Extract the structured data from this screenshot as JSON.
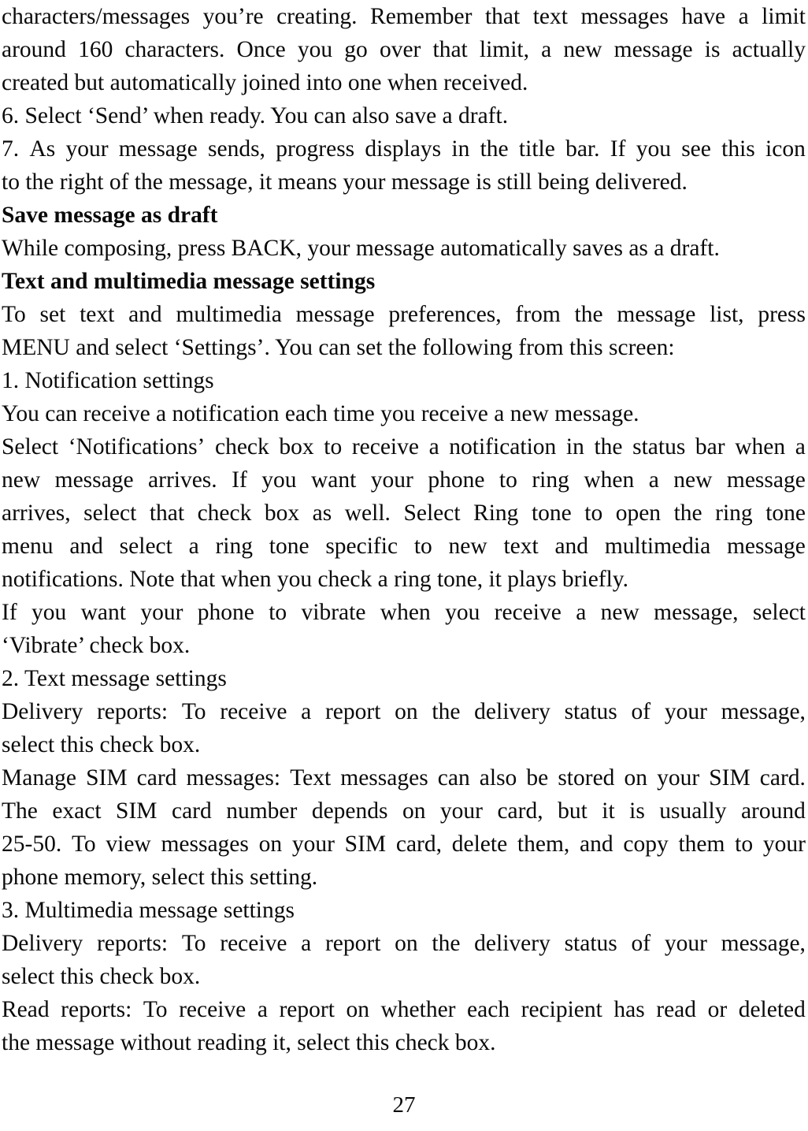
{
  "document": {
    "type": "user-manual-page",
    "page_number": "27",
    "language": "en",
    "body_lines": [
      {
        "text": "characters/messages you’re creating. Remember that text messages have a limit",
        "style": "justified"
      },
      {
        "text": "around 160 characters. Once you go over that limit, a new message is actually",
        "style": "justified"
      },
      {
        "text": "created but automatically joined into one when received.",
        "style": "normal"
      },
      {
        "text": "6. Select ‘Send’ when ready. You can also save a draft.",
        "style": "normal"
      },
      {
        "text": "7. As your message sends, progress displays in the title bar. If you see this icon",
        "style": "justified"
      },
      {
        "text": "to the right of the message, it means your message is still being delivered.",
        "style": "normal"
      },
      {
        "text": "Save message as draft",
        "style": "bold-heading"
      },
      {
        "text": "While composing, press BACK, your message automatically saves as a draft.",
        "style": "normal"
      },
      {
        "text": "Text and multimedia message settings",
        "style": "bold-heading"
      },
      {
        "text": "To set text and multimedia message preferences, from the message list, press",
        "style": "justified"
      },
      {
        "text": "MENU and select ‘Settings’. You can set the following from this screen:",
        "style": "normal"
      },
      {
        "text": "1. Notification settings",
        "style": "normal"
      },
      {
        "text": "You can receive a notification each time you receive a new message.",
        "style": "normal"
      },
      {
        "text": "Select ‘Notifications’ check box to receive a notification in the status bar when a",
        "style": "justified"
      },
      {
        "text": "new message arrives. If you want your phone to ring when a new message",
        "style": "justified"
      },
      {
        "text": "arrives, select that check box as well. Select Ring tone to open the ring tone",
        "style": "justified"
      },
      {
        "text": "menu and select a ring tone specific to new text and multimedia message",
        "style": "justified"
      },
      {
        "text": "notifications. Note that when you check a ring tone, it plays briefly.",
        "style": "normal"
      },
      {
        "text": "If you want your phone to vibrate when you receive a new message, select",
        "style": "justified"
      },
      {
        "text": "‘Vibrate’ check box.",
        "style": "normal"
      },
      {
        "text": "2. Text message settings",
        "style": "normal"
      },
      {
        "text": "Delivery reports: To receive a report on the delivery status of your message,",
        "style": "justified"
      },
      {
        "text": "select this check box.",
        "style": "normal"
      },
      {
        "text": "Manage SIM card messages: Text messages can also be stored on your SIM card.",
        "style": "justified"
      },
      {
        "text": "The exact SIM card number depends on your card, but it is usually around",
        "style": "justified"
      },
      {
        "text": "25-50. To view messages on your SIM card, delete them, and copy them to your",
        "style": "justified"
      },
      {
        "text": "phone memory, select this setting.",
        "style": "normal"
      },
      {
        "text": "3. Multimedia message settings",
        "style": "normal"
      },
      {
        "text": "Delivery reports: To receive a report on the delivery status of your message,",
        "style": "justified"
      },
      {
        "text": "select this check box.",
        "style": "normal"
      },
      {
        "text": "Read reports: To receive a report on whether each recipient has read or deleted",
        "style": "justified"
      },
      {
        "text": "the message without reading it, select this check box.",
        "style": "normal"
      }
    ]
  }
}
